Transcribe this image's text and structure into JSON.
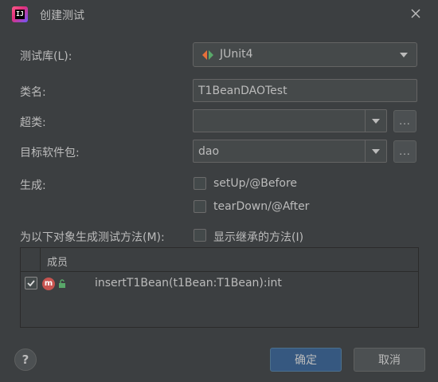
{
  "window": {
    "title": "创建测试"
  },
  "form": {
    "library_label": "测试库(L):",
    "library_value": "JUnit4",
    "classname_label": "类名:",
    "classname_value": "T1BeanDAOTest",
    "superclass_label": "超类:",
    "superclass_value": "",
    "package_label": "目标软件包:",
    "package_value": "dao",
    "browse_label": "...",
    "generate_label": "生成:",
    "setup_label": "setUp/@Before",
    "teardown_label": "tearDown/@After",
    "methods_label": "为以下对象生成测试方法(M):",
    "inherited_label": "显示继承的方法(I)"
  },
  "table": {
    "header": "成员",
    "rows": [
      {
        "checked": true,
        "label": "insertT1Bean(t1Bean:T1Bean):int",
        "icon": "m"
      }
    ]
  },
  "footer": {
    "help": "?",
    "ok": "确定",
    "cancel": "取消"
  },
  "colors": {
    "background": "#3c3f41",
    "primary_button": "#365880",
    "method_icon": "#c75450"
  }
}
